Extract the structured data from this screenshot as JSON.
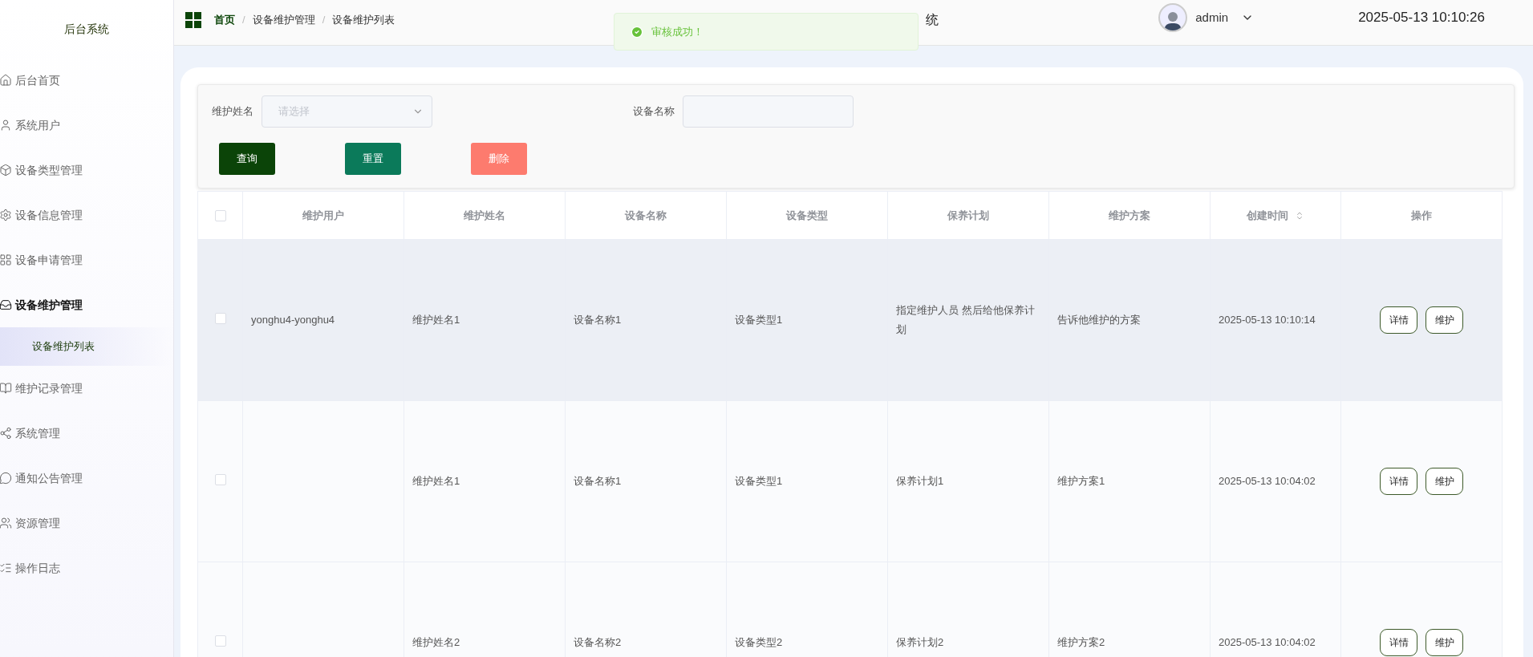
{
  "sidebar": {
    "title": "后台系统",
    "items": [
      {
        "label": "后台首页",
        "selected": false,
        "expanded": false
      },
      {
        "label": "系统用户",
        "selected": false,
        "expanded": false
      },
      {
        "label": "设备类型管理",
        "selected": false,
        "expanded": false
      },
      {
        "label": "设备信息管理",
        "selected": false,
        "expanded": false
      },
      {
        "label": "设备申请管理",
        "selected": false,
        "expanded": false
      },
      {
        "label": "设备维护管理",
        "selected": false,
        "expanded": true,
        "children": [
          {
            "label": "设备维护列表",
            "selected": true
          }
        ]
      },
      {
        "label": "维护记录管理",
        "selected": false,
        "expanded": false
      },
      {
        "label": "系统管理",
        "selected": false,
        "expanded": false
      },
      {
        "label": "通知公告管理",
        "selected": false,
        "expanded": false
      },
      {
        "label": "资源管理",
        "selected": false,
        "expanded": false
      },
      {
        "label": "操作日志",
        "selected": false,
        "expanded": false
      }
    ]
  },
  "header": {
    "breadcrumb": [
      "首页",
      "设备维护管理",
      "设备维护列表"
    ],
    "separator": "/",
    "title_visible": "统",
    "user": "admin",
    "datetime": "2025-05-13 10:10:26"
  },
  "toast": {
    "message": "审核成功！"
  },
  "filters": [
    {
      "label": "维护姓名",
      "kind": "select",
      "placeholder": "请选择"
    },
    {
      "label": "设备名称",
      "kind": "input"
    }
  ],
  "buttons": [
    {
      "label": "查询",
      "kind": "primary"
    },
    {
      "label": "重置",
      "kind": "secondary"
    },
    {
      "label": "删除",
      "kind": "danger"
    }
  ],
  "table": {
    "all_checked": false,
    "columns": [
      {
        "label": "维护用户",
        "sortable": false
      },
      {
        "label": "维护姓名",
        "sortable": false
      },
      {
        "label": "设备名称",
        "sortable": false
      },
      {
        "label": "设备类型",
        "sortable": false
      },
      {
        "label": "保养计划",
        "sortable": false
      },
      {
        "label": "维护方案",
        "sortable": false
      },
      {
        "label": "创建时间",
        "sortable": true
      },
      {
        "label": "操作",
        "sortable": false
      }
    ],
    "rows": [
      {
        "checked": false,
        "hovered": true,
        "cells": [
          "yonghu4-yonghu4",
          "维护姓名1",
          "设备名称1",
          "设备类型1",
          "指定维护人员 然后给他保养计划",
          "告诉他维护的方案",
          "2025-05-13 10:10:14"
        ],
        "actions": [
          "详情",
          "维护"
        ]
      },
      {
        "checked": false,
        "hovered": false,
        "cells": [
          "",
          "维护姓名1",
          "设备名称1",
          "设备类型1",
          "保养计划1",
          "维护方案1",
          "2025-05-13 10:04:02"
        ],
        "actions": [
          "详情",
          "维护"
        ]
      },
      {
        "checked": false,
        "hovered": false,
        "cells": [
          "",
          "维护姓名2",
          "设备名称2",
          "设备类型2",
          "保养计划2",
          "维护方案2",
          "2025-05-13 10:04:02"
        ],
        "actions": [
          "详情",
          "维护"
        ]
      }
    ]
  }
}
